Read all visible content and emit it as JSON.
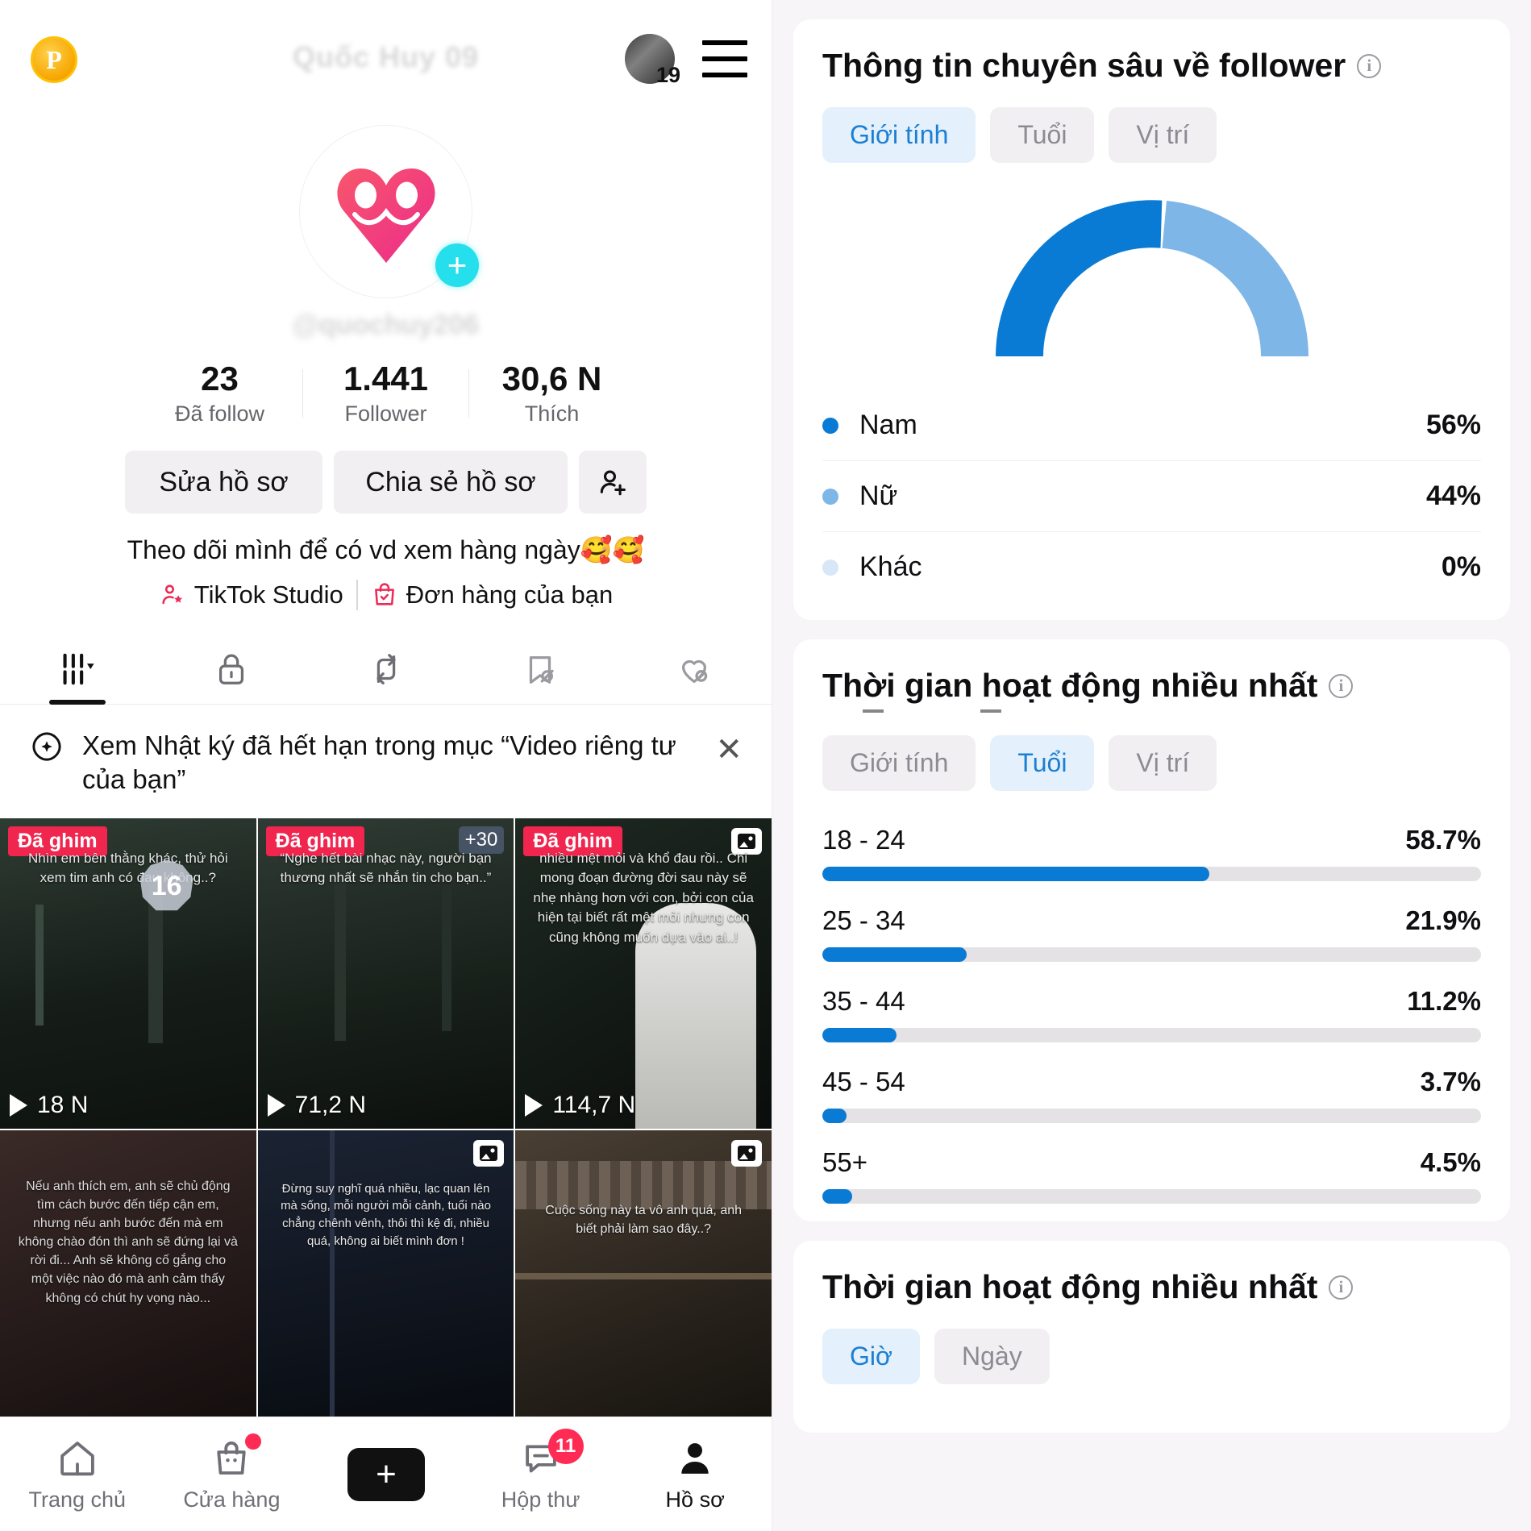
{
  "phone": {
    "top": {
      "coin_label": "P",
      "avatar_count": "19",
      "username_blurred": "Quốc Huy 09",
      "hamburger_icon": "hamburger-menu-icon",
      "avatar_icon": "user-avatar"
    },
    "profile": {
      "handle_blurred": "@quochuy206",
      "add_badge": "+"
    },
    "stats": [
      {
        "value": "23",
        "label": "Đã follow"
      },
      {
        "value": "1.441",
        "label": "Follower"
      },
      {
        "value": "30,6 N",
        "label": "Thích"
      }
    ],
    "actions": {
      "edit_label": "Sửa hồ sơ",
      "share_label": "Chia sẻ hồ sơ",
      "add_user_icon": "add-user-icon"
    },
    "bio": "Theo dõi mình để có vd xem hàng ngày🥰🥰",
    "links": [
      {
        "label": "TikTok Studio",
        "icon": "creator-star-icon"
      },
      {
        "label": "Đơn hàng của bạn",
        "icon": "shopping-bag-check-icon"
      }
    ],
    "content_tabs": [
      {
        "icon": "grid-posts-icon",
        "active": true
      },
      {
        "icon": "lock-private-icon",
        "active": false
      },
      {
        "icon": "repost-icon",
        "active": false
      },
      {
        "icon": "bookmark-off-icon",
        "active": false
      },
      {
        "icon": "heart-off-icon",
        "active": false
      }
    ],
    "notice": {
      "icon": "sparkle-plus-icon",
      "text": "Xem Nhật ký đã hết hạn trong mục “Video riêng tư của bạn”",
      "close_icon": "close-icon"
    },
    "videos": [
      {
        "pin_label": "Đã ghim",
        "caption": "Nhìn em bên thằng khác, thử hỏi xem tim anh có đau không..?",
        "views": "18 N",
        "chip": "16",
        "has_image_badge": false,
        "extra_badge": ""
      },
      {
        "pin_label": "Đã ghim",
        "caption": "“Nghe hết bài nhạc này, người bạn thương nhất sẽ nhắn tin cho bạn..”",
        "views": "71,2 N",
        "chip": "",
        "has_image_badge": false,
        "extra_badge": "+30"
      },
      {
        "pin_label": "Đã ghim",
        "caption": "nhiều mệt mỏi và khổ đau rồi.. Chỉ mong đoạn đường đời sau này sẽ nhẹ nhàng hơn với con, bởi con của hiện tại biết rất mệt mỏi nhưng con cũng không muốn dựa vào ai..!",
        "views": "114,7 N",
        "chip": "",
        "has_image_badge": true,
        "extra_badge": ""
      },
      {
        "pin_label": "",
        "caption": "Nếu anh thích em, anh sẽ chủ động tìm cách bước đến tiếp cận em, nhưng nếu anh bước đến mà em không chào đón thì anh sẽ đứng lại và rời đi... Anh sẽ không cố gắng cho một việc nào đó mà anh cảm thấy không có chút hy vọng nào...",
        "views": "",
        "chip": "",
        "has_image_badge": false,
        "extra_badge": ""
      },
      {
        "pin_label": "",
        "caption": "Đừng suy nghĩ quá nhiều, lạc quan lên mà sống, mỗi người mỗi cảnh, tuổi nào chẳng chênh vênh, thôi thì kệ đi, nhiều quá, không ai biết mình đơn !",
        "views": "",
        "chip": "",
        "has_image_badge": true,
        "extra_badge": ""
      },
      {
        "pin_label": "",
        "caption": "Cuộc sống này ta vô anh quá, anh biết phải làm sao đây..?",
        "views": "",
        "chip": "",
        "has_image_badge": true,
        "extra_badge": ""
      }
    ],
    "bottom_nav": [
      {
        "label": "Trang chủ",
        "icon": "home-icon",
        "active": false,
        "dot": false,
        "badge": ""
      },
      {
        "label": "Cửa hàng",
        "icon": "shop-bag-icon",
        "active": false,
        "dot": true,
        "badge": ""
      },
      {
        "label": "",
        "icon": "create-plus-icon",
        "active": false,
        "dot": false,
        "badge": ""
      },
      {
        "label": "Hộp thư",
        "icon": "inbox-message-icon",
        "active": false,
        "dot": false,
        "badge": "11"
      },
      {
        "label": "Hồ sơ",
        "icon": "profile-person-icon",
        "active": true,
        "dot": false,
        "badge": ""
      }
    ]
  },
  "analytics": {
    "follower_insights": {
      "title": "Thông tin chuyên sâu về follower",
      "info_icon": "info-icon",
      "tabs": [
        {
          "label": "Giới tính",
          "active": true
        },
        {
          "label": "Tuổi",
          "active": false
        },
        {
          "label": "Vị trí",
          "active": false
        }
      ]
    },
    "active_time_age": {
      "title": "Thời gian hoạt động nhiều nhất",
      "info_icon": "info-icon",
      "tabs": [
        {
          "label": "Giới tính",
          "active": false
        },
        {
          "label": "Tuổi",
          "active": true
        },
        {
          "label": "Vị trí",
          "active": false
        }
      ]
    },
    "active_time_hour": {
      "title": "Thời gian hoạt động nhiều nhất",
      "info_icon": "info-icon",
      "tabs": [
        {
          "label": "Giờ",
          "active": true
        },
        {
          "label": "Ngày",
          "active": false
        }
      ]
    }
  },
  "chart_data": [
    {
      "type": "pie",
      "title": "Giới tính",
      "labels": [
        "Nam",
        "Nữ",
        "Khác"
      ],
      "values": [
        56,
        44,
        0
      ],
      "value_labels": [
        "56%",
        "44%",
        "0%"
      ],
      "colors": [
        "#0a7bd4",
        "#7fb6e8",
        "#d7e7f7"
      ],
      "shape": "half-donut-gauge",
      "legend": "below"
    },
    {
      "type": "bar",
      "title": "Tuổi",
      "orientation": "horizontal",
      "categories": [
        "18 - 24",
        "25 - 34",
        "35 - 44",
        "45 - 54",
        "55+"
      ],
      "values": [
        58.7,
        21.9,
        11.2,
        3.7,
        4.5
      ],
      "value_labels": [
        "58.7%",
        "21.9%",
        "11.2%",
        "3.7%",
        "4.5%"
      ],
      "xlabel": "",
      "ylabel": "",
      "xlim": [
        0,
        100
      ],
      "grid": false,
      "bar_color": "#0a7bd4",
      "track_color": "#e4e2e4"
    }
  ]
}
